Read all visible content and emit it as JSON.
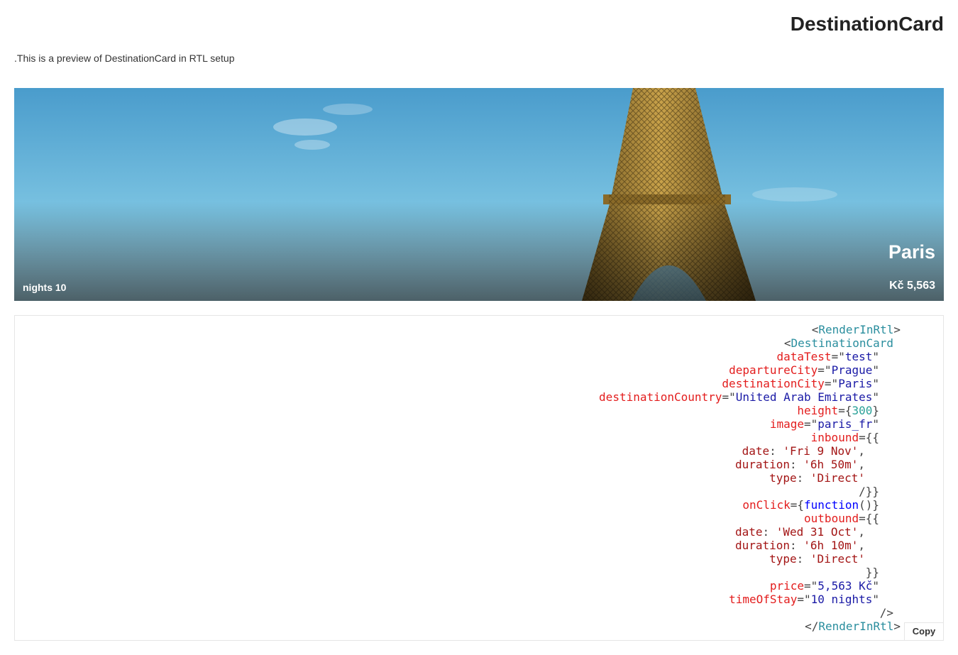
{
  "page": {
    "title": "DestinationCard",
    "description": ".This is a preview of DestinationCard in RTL setup"
  },
  "card": {
    "city": "Paris",
    "price": "Kč 5,563",
    "nights": "nights 10"
  },
  "code": {
    "lines": [
      [
        {
          "t": "<",
          "c": "pun"
        },
        {
          "t": "RenderInRtl",
          "c": "tag"
        },
        {
          "t": ">",
          "c": "pun"
        }
      ],
      [
        {
          "t": "DestinationCard",
          "c": "tag"
        },
        {
          "t": ">",
          "c": "pun"
        }
      ],
      [
        {
          "t": "\"",
          "c": "pun"
        },
        {
          "t": "dataTest",
          "c": "attr"
        },
        {
          "t": "=\"",
          "c": "pun"
        },
        {
          "t": "test",
          "c": "str"
        }
      ],
      [
        {
          "t": "\"",
          "c": "pun"
        },
        {
          "t": "departureCity",
          "c": "attr"
        },
        {
          "t": "=\"",
          "c": "pun"
        },
        {
          "t": "Prague",
          "c": "str"
        }
      ],
      [
        {
          "t": "\"",
          "c": "pun"
        },
        {
          "t": "destinationCity",
          "c": "attr"
        },
        {
          "t": "=\"",
          "c": "pun"
        },
        {
          "t": "Paris",
          "c": "str"
        }
      ],
      [
        {
          "t": "\"",
          "c": "pun"
        },
        {
          "t": "destinationCountry",
          "c": "attr"
        },
        {
          "t": "=\"",
          "c": "pun"
        },
        {
          "t": "United Arab Emirates",
          "c": "str"
        }
      ],
      [
        {
          "t": "{",
          "c": "pun"
        },
        {
          "t": "height",
          "c": "attr"
        },
        {
          "t": "={",
          "c": "pun"
        },
        {
          "t": "300",
          "c": "num"
        }
      ],
      [
        {
          "t": "\"",
          "c": "pun"
        },
        {
          "t": "image",
          "c": "attr"
        },
        {
          "t": "=\"",
          "c": "pun"
        },
        {
          "t": "paris_fr",
          "c": "str"
        }
      ],
      [
        {
          "t": "}}=",
          "c": "pun"
        },
        {
          "t": "inbound",
          "c": "attr"
        }
      ],
      [
        {
          "t": ",",
          "c": "pun"
        },
        {
          "t": "'date",
          "c": "key"
        },
        {
          "t": ": ",
          "c": "pun"
        },
        {
          "t": "'Fri 9 Nov",
          "c": "sval"
        }
      ],
      [
        {
          "t": ",",
          "c": "pun"
        },
        {
          "t": "'duration",
          "c": "key"
        },
        {
          "t": ": ",
          "c": "pun"
        },
        {
          "t": "'6h 50m",
          "c": "sval"
        }
      ],
      [
        {
          "t": "'type",
          "c": "key"
        },
        {
          "t": ": ",
          "c": "pun"
        },
        {
          "t": "'Direct",
          "c": "sval"
        }
      ],
      [
        {
          "t": "{{/",
          "c": "pun"
        }
      ],
      [
        {
          "t": "{()",
          "c": "pun"
        },
        {
          "t": "onClick",
          "c": "attr"
        },
        {
          "t": "={",
          "c": "pun"
        },
        {
          "t": "function",
          "c": "kw"
        }
      ],
      [
        {
          "t": "}}=",
          "c": "pun"
        },
        {
          "t": "outbound",
          "c": "attr"
        }
      ],
      [
        {
          "t": ",",
          "c": "pun"
        },
        {
          "t": "'date",
          "c": "key"
        },
        {
          "t": ": ",
          "c": "pun"
        },
        {
          "t": "'Wed 31 Oct",
          "c": "sval"
        }
      ],
      [
        {
          "t": ",",
          "c": "pun"
        },
        {
          "t": "'duration",
          "c": "key"
        },
        {
          "t": ": ",
          "c": "pun"
        },
        {
          "t": "'6h 10m",
          "c": "sval"
        }
      ],
      [
        {
          "t": "'type",
          "c": "key"
        },
        {
          "t": ": ",
          "c": "pun"
        },
        {
          "t": "'Direct",
          "c": "sval"
        }
      ],
      [
        {
          "t": "{{",
          "c": "pun"
        }
      ],
      [
        {
          "t": "\"",
          "c": "pun"
        },
        {
          "t": "price",
          "c": "attr"
        },
        {
          "t": "=\"",
          "c": "pun"
        },
        {
          "t": "5,563 Kč",
          "c": "str"
        }
      ],
      [
        {
          "t": "\"",
          "c": "pun"
        },
        {
          "t": "timeOfStay",
          "c": "attr"
        },
        {
          "t": "=\"",
          "c": "pun"
        },
        {
          "t": "10 nights",
          "c": "str"
        }
      ],
      [
        {
          "t": "</",
          "c": "pun"
        }
      ],
      [
        {
          "t": "<",
          "c": "pun"
        },
        {
          "t": "RenderInRtl",
          "c": "tag"
        },
        {
          "t": "/>",
          "c": "pun"
        }
      ]
    ],
    "indent": [
      0,
      1,
      3,
      3,
      3,
      3,
      3,
      3,
      3,
      5,
      5,
      5,
      3,
      3,
      3,
      5,
      5,
      5,
      3,
      3,
      3,
      1,
      0
    ],
    "copy_label": "Copy"
  }
}
